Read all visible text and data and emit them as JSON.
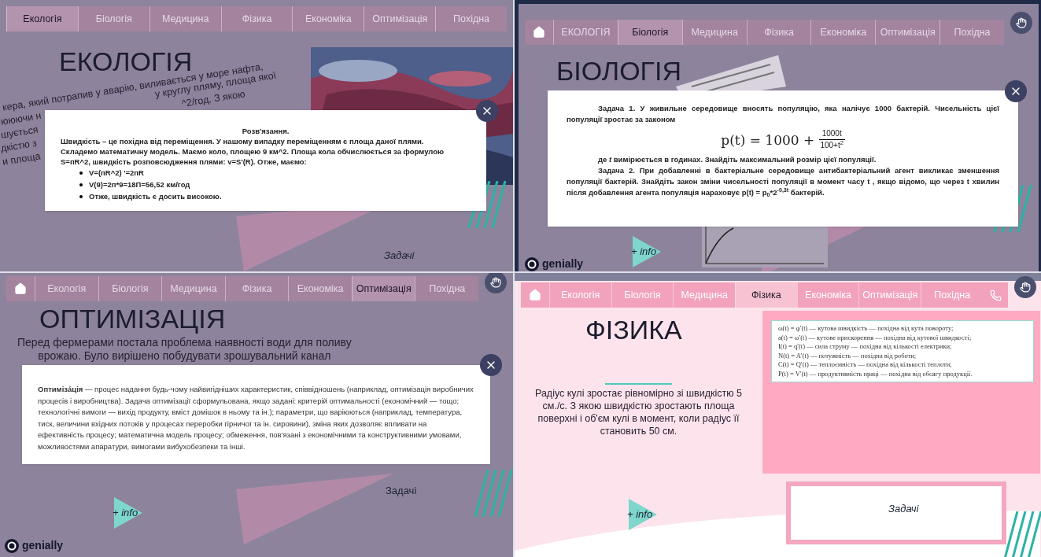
{
  "panels": [
    {
      "kind": "ecology",
      "dimmed": true,
      "home": false,
      "corner_button": false,
      "phone": false,
      "tabs": [
        {
          "label": "Екологія",
          "selected": true
        },
        {
          "label": "Біологія",
          "selected": false
        },
        {
          "label": "Медицина",
          "selected": false
        },
        {
          "label": "Фізика",
          "selected": false
        },
        {
          "label": "Економіка",
          "selected": false
        },
        {
          "label": "Оптимізація",
          "selected": false
        },
        {
          "label": "Похідна",
          "selected": false
        }
      ],
      "title": "ЕКОЛОГІЯ",
      "body": [
        "кера, який потрапив у аварію, виливається у море нафта,",
        "ююючи н",
        "шується",
        "дкістю з",
        "и площа"
      ],
      "body_right": [
        "у круглу пляму, площа якої",
        "^2/год. З якою"
      ],
      "modal": {
        "kind": "solution",
        "heading": "Розв'язання.",
        "paragraphs": [
          "Швидкість – це похідна від переміщення. У нашому випадку переміщенням є площа даної плями.",
          "Складемо математичну модель. Маємо коло, площею 9 км^2. Площа кола обчислюється за формулою S=пR^2, швидкість розповсюдження плями: v=S'(R). Отже, маємо:"
        ],
        "bullets": [
          "V=(пR^2) '=2пR",
          "V(9)=2п*9=18П=56,52 км/год",
          "Отже, швидкість є досить високою."
        ]
      },
      "zadachi": {
        "text": "Задачі",
        "italic": true
      }
    },
    {
      "kind": "biology",
      "dimmed": true,
      "home": true,
      "corner_button": true,
      "phone": false,
      "tabs": [
        {
          "label": "ЕКОЛОГІЯ",
          "selected": false
        },
        {
          "label": "Біологія",
          "selected": true
        },
        {
          "label": "Медицина",
          "selected": false
        },
        {
          "label": "Фізика",
          "selected": false
        },
        {
          "label": "Економіка",
          "selected": false
        },
        {
          "label": "Оптимізація",
          "selected": false
        },
        {
          "label": "Похідна",
          "selected": false
        }
      ],
      "title": "БІОЛОГІЯ",
      "modal": {
        "kind": "tasks",
        "task1": "**Задача 1.** У живильне середовище вносять популяцію, яка налічує 1000 бактерій. Чисельність цієї популяції зростає за законом",
        "formula_left": "p(t) = 1000 + ",
        "numerator": "1000t",
        "denominator": "100+t$^{2}$",
        "after": "де *t* вимірюється в годинах. Знайдіть максимальний розмір цієї популяції.",
        "task2": "Задача 2. При добавленні в бактеріальне середовище антибактеріальний агент викликає зменшення популяції бактерій. Знайдіть закон зміни чисельності популяції в момент часу t , якщо відомо, що через t хвилин після добавлення агента популяція нараховує p(t) = p$_{0}$*2$^{-0,3t}$ бактерій."
      },
      "info": "+ info",
      "logo": "genially"
    },
    {
      "kind": "optimization",
      "dimmed": true,
      "home": true,
      "corner_button": true,
      "phone": false,
      "tabs": [
        {
          "label": "Екологія",
          "selected": false
        },
        {
          "label": "Біологія",
          "selected": false
        },
        {
          "label": "Медицина",
          "selected": false
        },
        {
          "label": "Фізика",
          "selected": false
        },
        {
          "label": "Економіка",
          "selected": false
        },
        {
          "label": "Оптимізація",
          "selected": true
        },
        {
          "label": "Похідна",
          "selected": false
        }
      ],
      "title": "ОПТИМІЗАЦІЯ",
      "body": [
        "Перед фермерами постала проблема наявності води для поливу",
        "врожаю. Було вирішено побудувати зрошувальний канал"
      ],
      "modal": {
        "kind": "definition",
        "text": "**Оптимізáція** — процес надання будь-чому найвигідніших характеристик, співвідношень (наприклад, оптимізація виробничих процесів і виробництва). Задача оптимізації сформульована, якщо задані: критерій оптимальності (економічний — тощо; технологічні вимоги — вихід продукту, вміст домішок в ньому та ін.); параметри, що варіюються (наприклад, температура, тиск, величини вхідних потоків у процесах переробки гірничої та ін. сировини), зміна яких дозволяє впливати на ефективність процесу; математична модель процесу; обмеження, пов'язані з економічними та конструктивними умовами, можливостями апаратури, вимогами вибухобезпеки та інші."
      },
      "zadachi": {
        "text": "Задачі",
        "italic": false
      },
      "info": "+ info",
      "logo": "genially"
    },
    {
      "kind": "physics",
      "dimmed": false,
      "home": true,
      "corner_button": true,
      "phone": true,
      "tabs": [
        {
          "label": "Екологія",
          "selected": false
        },
        {
          "label": "Біологія",
          "selected": false
        },
        {
          "label": "Медицина",
          "selected": false
        },
        {
          "label": "Фізика",
          "selected": true
        },
        {
          "label": "Економіка",
          "selected": false
        },
        {
          "label": "Оптимізація",
          "selected": false
        },
        {
          "label": "Похідна",
          "selected": false
        }
      ],
      "title": "ФІЗИКА",
      "body": [
        "Радіус кулі зростає рівномірно зі швидкістю 5 см./с. З якою швидкістю зростають площа поверхні і об'єм кулі в момент, коли радіус її становить 50 см."
      ],
      "formulas": [
        "ω(t) = φ′(t) — кутова швидкість — похідна від кута повороту;",
        "a(t) = ω′(t) — кутове прискорення — похідна від кутової швидкості;",
        "I(t) = q′(t) — сила струму — похідна від кількості електрики;",
        "N(t) = A′(t) — потужність — похідна від роботи;",
        "C(t) = Q′(t) — теплоємність — похідна від кількості теплоти;",
        "P(t) = V′(t) — продуктивність праці — похідна від обсягу продукції."
      ],
      "zadachi": {
        "text": "Задачі",
        "italic": true
      },
      "info": "+ info"
    }
  ]
}
